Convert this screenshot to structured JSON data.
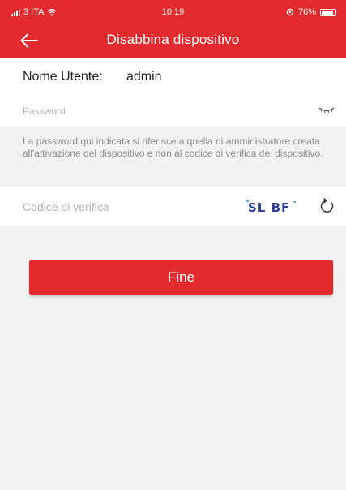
{
  "status_bar": {
    "carrier": "3 ITA",
    "time": "10:19",
    "battery": "76%"
  },
  "nav": {
    "title": "Disabbina dispositivo",
    "back_icon": "arrow-left-icon"
  },
  "form": {
    "username_label": "Nome Utente:",
    "username_value": "admin",
    "password_placeholder": "Password",
    "password_hint": "La password qui indicata si riferisce a quella di amministratore creata all'attivazione del dispositivo e non al codice di verifica del dispositivo.",
    "verification_placeholder": "Codice di verifica",
    "captcha_text": "SL BF"
  },
  "actions": {
    "done_label": "Fine"
  },
  "colors": {
    "accent": "#e32b2e",
    "background": "#f2f2f2"
  }
}
